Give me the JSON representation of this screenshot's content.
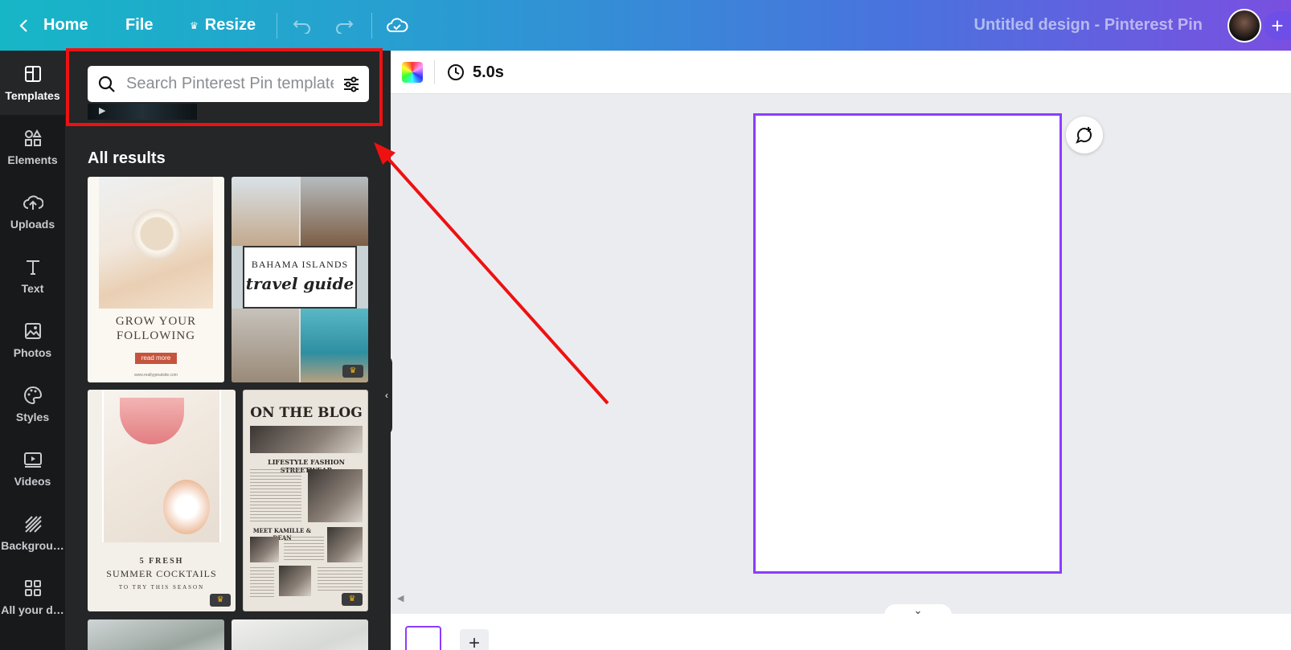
{
  "topbar": {
    "home_label": "Home",
    "file_label": "File",
    "resize_label": "Resize",
    "design_title": "Untitled design - Pinterest Pin"
  },
  "rail": {
    "items": [
      {
        "label": "Templates",
        "icon": "templates-icon"
      },
      {
        "label": "Elements",
        "icon": "elements-icon"
      },
      {
        "label": "Uploads",
        "icon": "upload-cloud-icon"
      },
      {
        "label": "Text",
        "icon": "text-icon"
      },
      {
        "label": "Photos",
        "icon": "photo-icon"
      },
      {
        "label": "Styles",
        "icon": "palette-icon"
      },
      {
        "label": "Videos",
        "icon": "video-icon"
      },
      {
        "label": "Backgrou…",
        "icon": "background-pattern-icon"
      },
      {
        "label": "All your d…",
        "icon": "grid-icon"
      }
    ]
  },
  "panel": {
    "search_placeholder": "Search Pinterest Pin templates",
    "results_title": "All results",
    "templates": [
      {
        "lines": [
          "GROW YOUR",
          "FOLLOWING"
        ],
        "button": "read more",
        "url": "www.reallygreatsite.com"
      },
      {
        "lines": [
          "BAHAMA ISLANDS",
          "travel guide"
        ],
        "premium": true
      },
      {
        "lines": [
          "5 FRESH",
          "SUMMER COCKTAILS",
          "TO TRY THIS SEASON"
        ],
        "premium": true
      },
      {
        "lines": [
          "ON THE BLOG",
          "LIFESTYLE FASHION STREETWEAR",
          "MEET KAMILLE & DEAN"
        ],
        "premium": true
      }
    ]
  },
  "canvas": {
    "duration": "5.0s"
  },
  "colors": {
    "accent": "#8b3dff",
    "annotation": "#ee1111"
  }
}
